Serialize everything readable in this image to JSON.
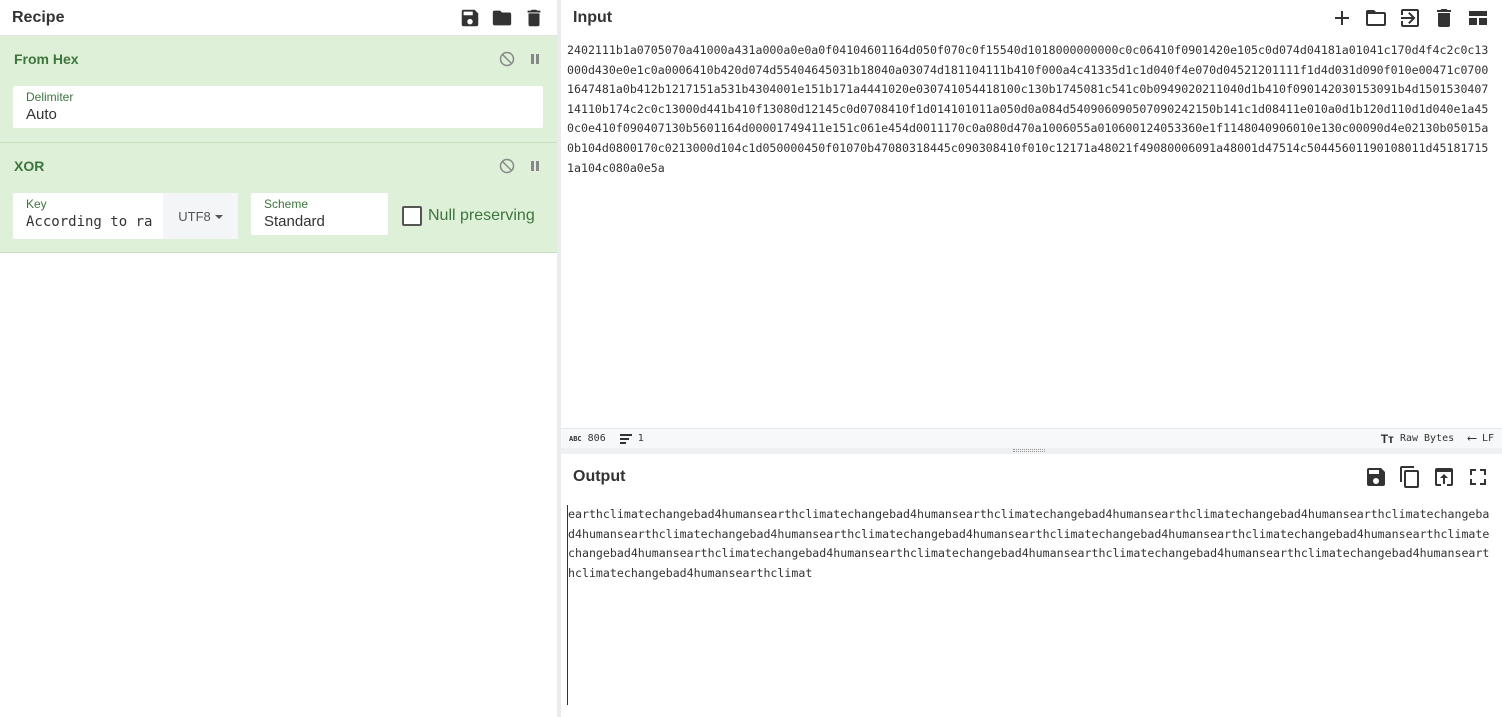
{
  "recipe": {
    "title": "Recipe",
    "operations": [
      {
        "name": "From Hex",
        "fields": [
          {
            "label": "Delimiter",
            "value": "Auto"
          }
        ]
      },
      {
        "name": "XOR",
        "key_label": "Key",
        "key_value": "According to ra",
        "key_encoding": "UTF8",
        "scheme_label": "Scheme",
        "scheme_value": "Standard",
        "null_preserving_label": "Null preserving",
        "null_preserving_checked": false
      }
    ]
  },
  "input": {
    "title": "Input",
    "text": "2402111b1a0705070a41000a431a000a0e0a0f04104601164d050f070c0f15540d1018000000000c0c06410f0901420e105c0d074d04181a01041c170d4f4c2c0c13000d430e0e1c0a0006410b420d074d55404645031b18040a03074d181104111b410f000a4c41335d1c1d040f4e070d04521201111f1d4d031d090f010e00471c07001647481a0b412b1217151a531b4304001e151b171a4441020e030741054418100c130b1745081c541c0b0949020211040d1b410f090142030153091b4d150153040714110b174c2c0c13000d441b410f13080d12145c0d0708410f1d014101011a050d0a084d540906090507090242150b141c1d08411e010a0d1b120d110d1d040e1a450c0e410f090407130b5601164d00001749411e151c061e454d0011170c0a080d470a1006055a010600124053360e1f1148040906010e130c00090d4e02130b05015a0b104d0800170c0213000d104c1d050000450f01070b47080318445c090308410f010c12171a48021f49080006091a48001d47514c50445601190108011d451817151a104c080a0e5a",
    "char_count": "806",
    "line_count": "1",
    "encoding": "Raw Bytes",
    "eol": "LF"
  },
  "output": {
    "title": "Output",
    "text": "earthclimatechangebad4humansearthclimatechangebad4humansearthclimatechangebad4humansearthclimatechangebad4humansearthclimatechangebad4humansearthclimatechangebad4humansearthclimatechangebad4humansearthclimatechangebad4humansearthclimatechangebad4humansearthclimatechangebad4humansearthclimatechangebad4humansearthclimatechangebad4humansearthclimatechangebad4humansearthclimatechangebad4humansearthclimatechangebad4humansearthclimat"
  }
}
